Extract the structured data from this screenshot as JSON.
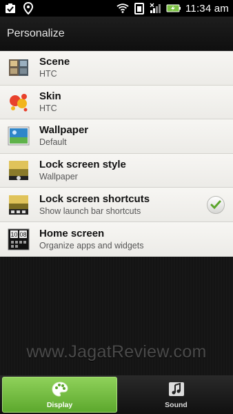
{
  "statusbar": {
    "icons_left": [
      "task-check-icon",
      "location-icon"
    ],
    "icons_right": [
      "wifi-icon",
      "battery-saver-icon",
      "signal-icon",
      "battery-charging-icon"
    ],
    "time": "11:34 am"
  },
  "header": {
    "title": "Personalize"
  },
  "list": {
    "items": [
      {
        "title": "Scene",
        "subtitle": "HTC",
        "icon": "scene-thumbnail"
      },
      {
        "title": "Skin",
        "subtitle": "HTC",
        "icon": "skin-thumbnail"
      },
      {
        "title": "Wallpaper",
        "subtitle": "Default",
        "icon": "wallpaper-thumbnail"
      },
      {
        "title": "Lock screen style",
        "subtitle": "Wallpaper",
        "icon": "lockscreen-thumbnail"
      },
      {
        "title": "Lock screen shortcuts",
        "subtitle": "Show launch bar shortcuts",
        "icon": "lockscreen-shortcuts-thumbnail",
        "checked": true
      },
      {
        "title": "Home screen",
        "subtitle": "Organize apps and widgets",
        "icon": "home-screen-thumbnail"
      }
    ]
  },
  "watermark": "www.JagatReview.com",
  "tabs": [
    {
      "label": "Display",
      "icon": "palette-icon",
      "active": true
    },
    {
      "label": "Sound",
      "icon": "music-note-icon",
      "active": false
    }
  ],
  "colors": {
    "accent_green": "#7cc144",
    "check_green": "#5aa52a"
  }
}
